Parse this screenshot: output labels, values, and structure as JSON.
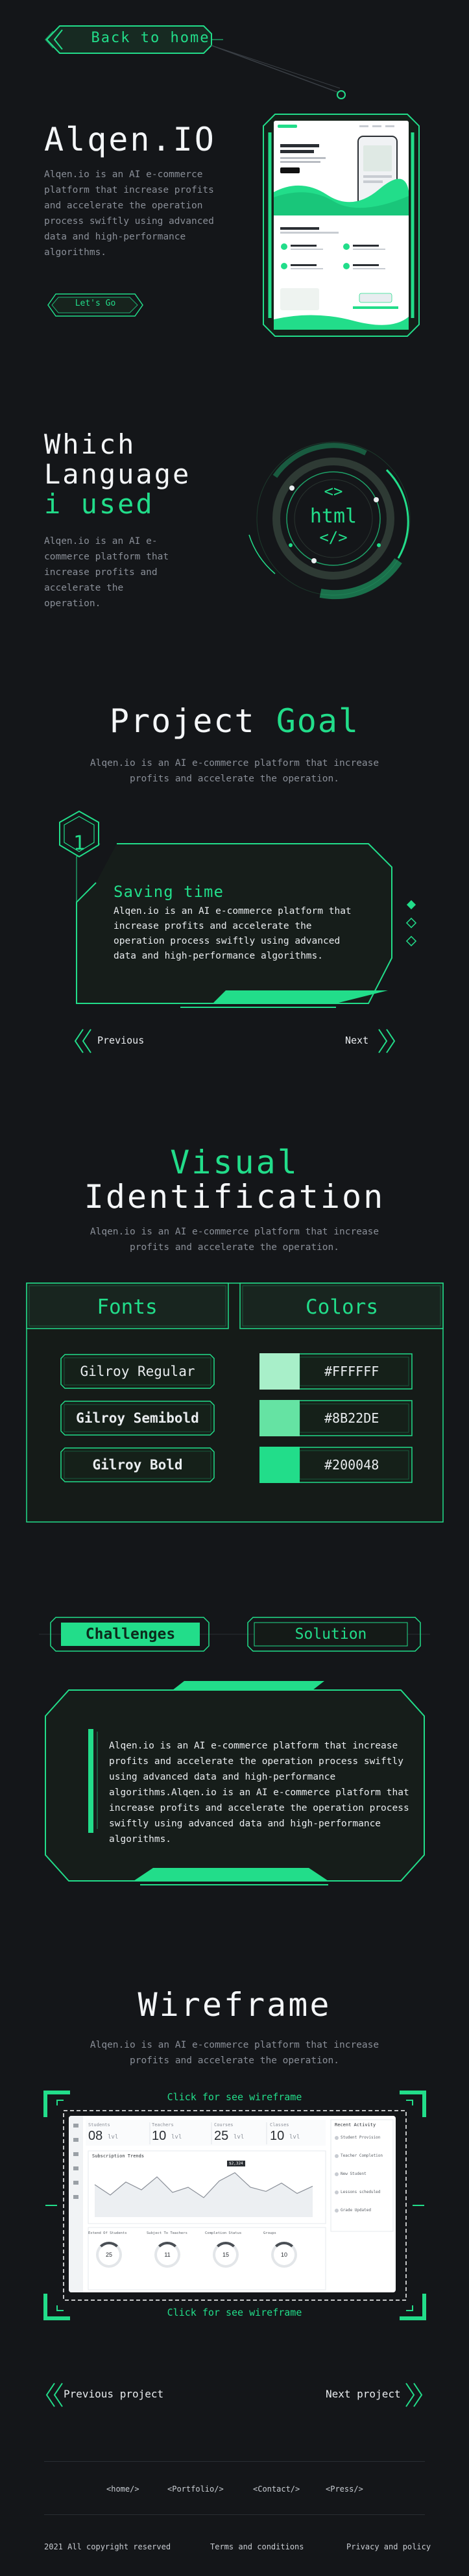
{
  "nav": {
    "back_label": "Back to home"
  },
  "hero": {
    "title": "Alqen.IO",
    "description": "Alqen.io is an AI e-commerce platform that increase profits and accelerate the operation process swiftly using advanced data and high-performance algorithms.",
    "cta_label": "Let's Go",
    "preview": {
      "logo": "alqen.io",
      "menu": [
        "Features",
        "Pricing",
        "Contact"
      ],
      "headline": "Discover your newly fresh your iPhone and iPad",
      "sub_headline": "Features of the app",
      "store_label": "App Store",
      "footer_label": "Download available in store",
      "features": [
        "Sales Analytics",
        "Smart Sync",
        "Fast Delivery",
        "Notifications"
      ]
    }
  },
  "language": {
    "title_line1": "Which",
    "title_line2": "Language",
    "title_line3": "i used",
    "description": "Alqen.io is an AI e-commerce platform that increase profits and accelerate the operation.",
    "badge_top": "<>",
    "badge_mid": "html",
    "badge_bottom": "</>"
  },
  "goal": {
    "title_white": "Project ",
    "title_green": "Goal",
    "description": "Alqen.io is an AI e-commerce platform that increase profits and accelerate the operation.",
    "card": {
      "number": "1",
      "title": "Saving time",
      "text": "Alqen.io is an AI e-commerce platform that increase profits and accelerate the operation process swiftly using advanced data and high-performance algorithms."
    },
    "prev_label": "Previous",
    "next_label": "Next"
  },
  "visual": {
    "title_line1": "Visual",
    "title_line2": "Identification",
    "description": "Alqen.io is an AI e-commerce platform that increase profits and accelerate the operation.",
    "fonts_label": "Fonts",
    "colors_label": "Colors",
    "fonts": [
      "Gilroy Regular",
      "Gilroy Semibold",
      "Gilroy Bold"
    ],
    "colors": [
      {
        "hex": "#FFFFFF",
        "swatch": "#a8efc9"
      },
      {
        "hex": "#8B22DE",
        "swatch": "#65e3a3"
      },
      {
        "hex": "#200048",
        "swatch": "#22dd8a"
      }
    ]
  },
  "challenges": {
    "challenges_label": "Challenges",
    "solution_label": "Solution",
    "text": "Alqen.io is an AI e-commerce platform that increase profits and accelerate the operation process swiftly using advanced data and high-performance algorithms.Alqen.io is an AI e-commerce platform that increase profits and accelerate the operation process swiftly using advanced data and high-performance algorithms."
  },
  "wireframe": {
    "title": "Wireframe",
    "description": "Alqen.io is an AI e-commerce platform that increase profits and accelerate the operation.",
    "link_top": "Click for see wireframe",
    "link_bottom": "Click for see wireframe",
    "stats": [
      {
        "label": "Students",
        "value": "08",
        "unit": "lvl"
      },
      {
        "label": "Teachers",
        "value": "10",
        "unit": "lvl"
      },
      {
        "label": "Courses",
        "value": "25",
        "unit": "lvl"
      },
      {
        "label": "Classes",
        "value": "10",
        "unit": "lvl"
      }
    ],
    "chart_title": "Subscription Trends",
    "tooltip": "$2,324",
    "activity_title": "Recent Activity",
    "activities": [
      "Student Provision",
      "Teacher Completion",
      "New Student",
      "Lessons scheduled",
      "Grade Updated"
    ],
    "gauges": [
      {
        "label": "Extend Of Students",
        "value": "25"
      },
      {
        "label": "Subject To Teachers",
        "value": "11"
      },
      {
        "label": "Completion Status",
        "value": "15"
      },
      {
        "label": "Groups",
        "value": "10"
      }
    ]
  },
  "project_nav": {
    "prev_label": "Previous project",
    "next_label": "Next project"
  },
  "footer": {
    "links": [
      "<home/>",
      "<Portfolio/>",
      "<Contact/>",
      "<Press/>"
    ],
    "copyright": "2021 All copyright reserved",
    "terms": "Terms and conditions",
    "privacy": "Privacy and policy"
  },
  "colors": {
    "accent": "#22dd8a",
    "background": "#141619",
    "panel": "#171d1b",
    "muted": "#8a8f98"
  }
}
